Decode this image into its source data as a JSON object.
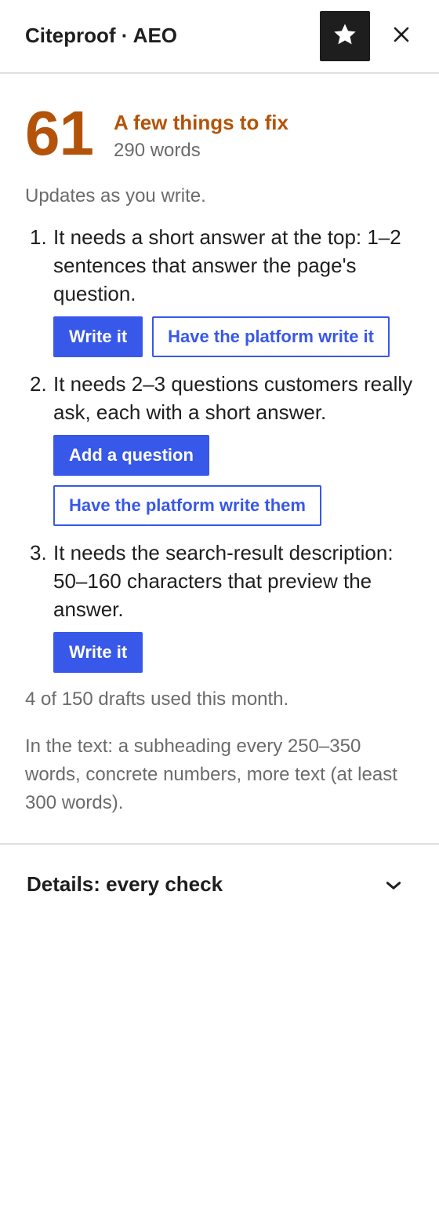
{
  "header": {
    "title": "Citeproof · AEO",
    "star_icon": "star-icon",
    "close_icon": "close-icon"
  },
  "score": {
    "value": "61",
    "label": "A few things to fix",
    "words": "290 words",
    "color": "#b35309"
  },
  "updates_note": "Updates as you write.",
  "items": [
    {
      "number": "1.",
      "text": "It needs a short answer at the top: 1–2 sentences that answer the page's question.",
      "buttons": [
        {
          "label": "Write it",
          "style": "primary"
        },
        {
          "label": "Have the platform write it",
          "style": "secondary"
        }
      ]
    },
    {
      "number": "2.",
      "text": "It needs 2–3 questions customers really ask, each with a short answer.",
      "buttons": [
        {
          "label": "Add a question",
          "style": "primary"
        },
        {
          "label": "Have the platform write them",
          "style": "secondary"
        }
      ]
    },
    {
      "number": "3.",
      "text": "It needs the search-result description: 50–160 characters that preview the answer.",
      "buttons": [
        {
          "label": "Write it",
          "style": "primary"
        }
      ]
    }
  ],
  "drafts_usage": "4 of 150 drafts used this month.",
  "hint": "In the text: a subheading every 250–350 words, concrete numbers, more text (at least 300 words).",
  "details": {
    "label": "Details: every check",
    "icon": "chevron-down-icon"
  },
  "colors": {
    "accent": "#3858e9",
    "score": "#b35309",
    "muted": "#6b6b6b"
  }
}
